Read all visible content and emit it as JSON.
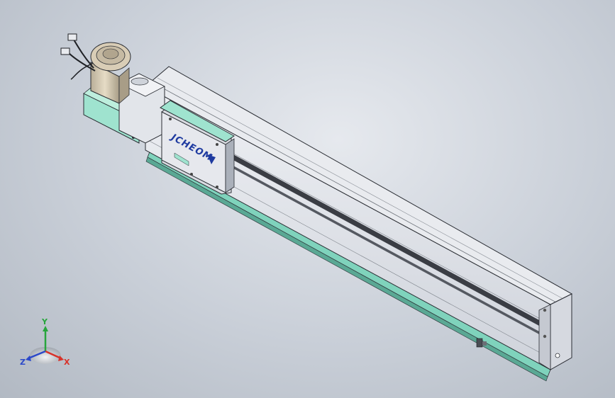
{
  "model": {
    "name": "linear-actuator-module",
    "carriage_logo": "JCHEOM",
    "colors": {
      "background": "#c9cfd8",
      "body": "#e4e6ec",
      "body_shadow": "#b7bcc6",
      "accent_teal": "#9fe3cf",
      "motor_tan": "#d9cdb6",
      "edge": "#2a2d33"
    }
  },
  "triad": {
    "x_label": "X",
    "y_label": "Y",
    "z_label": "Z",
    "colors": {
      "x": "#d8322a",
      "y": "#27a53c",
      "z": "#2c49c9"
    }
  }
}
